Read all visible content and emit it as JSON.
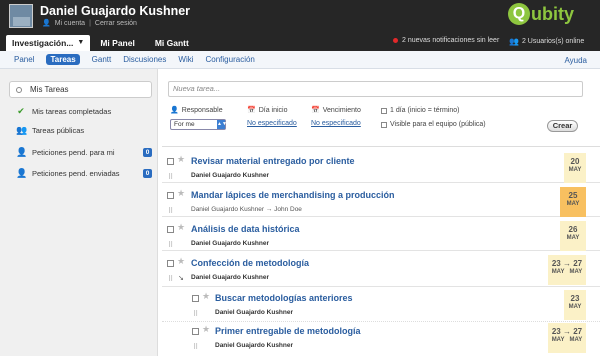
{
  "user": {
    "name": "Daniel Guajardo Kushner",
    "account": "Mi cuenta",
    "logout": "Cerrar sesión"
  },
  "logo": {
    "letter": "Q",
    "text": "ubity"
  },
  "nav": {
    "tabs": [
      "Investigación...",
      "Mi Panel",
      "Mi Gantt"
    ]
  },
  "notifications": "2 nuevas notificaciones sin leer",
  "online": "2 Usuarios(s) online",
  "subnav": {
    "items": [
      "Panel",
      "Tareas",
      "Gantt",
      "Discusiones",
      "Wiki",
      "Configuración"
    ],
    "help": "Ayuda"
  },
  "sidebar": {
    "search_label": "Mis Tareas",
    "items": [
      {
        "label": "Mis tareas completadas"
      },
      {
        "label": "Tareas públicas"
      },
      {
        "label": "Peticiones pend. para mi",
        "count": "0"
      },
      {
        "label": "Peticiones pend. enviadas",
        "count": "0"
      }
    ]
  },
  "form": {
    "placeholder": "Nueva tarea...",
    "responsable": "Responsable",
    "responsable_value": "For me",
    "dia_inicio": "Día inicio",
    "dia_inicio_value": "No especificado",
    "vencimiento": "Vencimiento",
    "vencimiento_value": "No especificado",
    "opt1": "1 día (inicio = término)",
    "opt2": "Visible para el equipo (pública)",
    "crear": "Crear"
  },
  "tasks": [
    {
      "title": "Revisar material entregado por cliente",
      "who": "Daniel Guajardo Kushner",
      "d1": "20",
      "m1": "MAY"
    },
    {
      "title": "Mandar lápices de merchandising a producción",
      "who": "Daniel Guajardo Kushner → John Doe",
      "d1": "25",
      "m1": "MAY"
    },
    {
      "title": "Análisis de data histórica",
      "who": "Daniel Guajardo Kushner",
      "d1": "26",
      "m1": "MAY"
    },
    {
      "title": "Confección de metodología",
      "who": "Daniel Guajardo Kushner",
      "d1": "23",
      "m1": "MAY",
      "d2": "27",
      "m2": "MAY"
    },
    {
      "title": "Buscar metodologías anteriores",
      "who": "Daniel Guajardo Kushner",
      "d1": "23",
      "m1": "MAY"
    },
    {
      "title": "Primer entregable de metodología",
      "who": "Daniel Guajardo Kushner",
      "d1": "23",
      "m1": "MAY",
      "d2": "27",
      "m2": "MAY"
    }
  ],
  "colors": {
    "accent": "#2a6cc0",
    "brand": "#8ec63f",
    "date_bg": "#fbf1c7",
    "date_due": "#f8c060"
  }
}
